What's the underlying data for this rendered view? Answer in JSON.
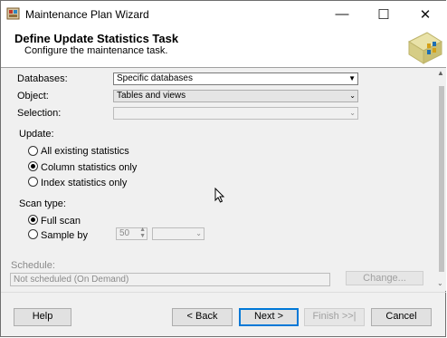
{
  "window": {
    "title": "Maintenance Plan Wizard",
    "minimize_glyph": "—",
    "maximize_glyph": "☐",
    "close_glyph": "✕"
  },
  "header": {
    "title": "Define Update Statistics Task",
    "subtitle": "Configure the maintenance task."
  },
  "form": {
    "databases_label": "Databases:",
    "databases_value": "Specific databases",
    "object_label": "Object:",
    "object_value": "Tables and views",
    "selection_label": "Selection:",
    "selection_value": "",
    "update_label": "Update:",
    "update_options": [
      {
        "label": "All existing statistics",
        "selected": false
      },
      {
        "label": "Column statistics only",
        "selected": true
      },
      {
        "label": "Index statistics only",
        "selected": false
      }
    ],
    "scan_label": "Scan type:",
    "scan_full": "Full scan",
    "scan_sample": "Sample by",
    "sample_value": "50",
    "sample_unit": "",
    "schedule_label": "Schedule:",
    "schedule_value": "Not scheduled (On Demand)",
    "change_button": "Change..."
  },
  "footer": {
    "help": "Help",
    "back": "< Back",
    "next": "Next >",
    "finish": "Finish >>|",
    "cancel": "Cancel"
  }
}
